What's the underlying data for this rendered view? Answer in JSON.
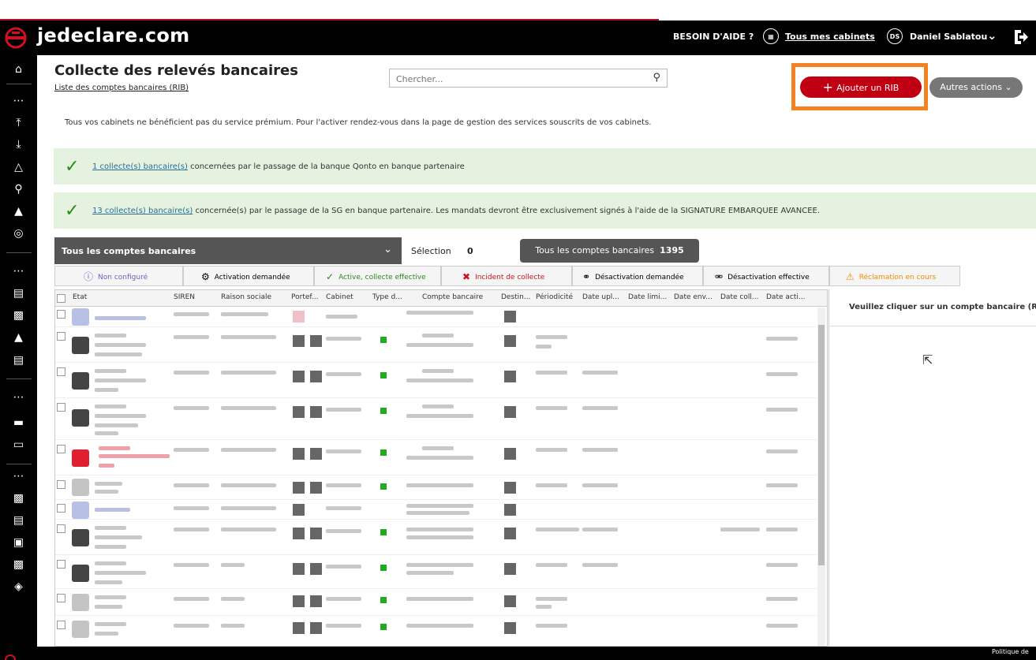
{
  "header": {
    "brand": "jedeclare.com",
    "help": "BESOIN D'AIDE ?",
    "cabinets": "Tous mes cabinets",
    "user_initials": "DS",
    "user_name": "Daniel Sablatou",
    "icons": [
      "logo-icon",
      "building-icon",
      "chevron-down-icon",
      "logout-icon"
    ]
  },
  "page": {
    "title": "Collecte des relevés bancaires",
    "subtitle_link": "Liste des comptes bancaires (RIB)",
    "search_placeholder": "Chercher...",
    "add_rib": "Ajouter un RIB",
    "other_actions": "Autres actions",
    "premium_note": "Tous vos cabinets ne bénéficient pas du service prémium. Pour l'activer rendez-vous dans la page de gestion des services souscrits de vos cabinets."
  },
  "banners": [
    {
      "link": "1 collecte(s) bancaire(s)",
      "text": " concernées par le passage de la banque Qonto en banque partenaire"
    },
    {
      "link": "13 collecte(s) bancaire(s)",
      "text": " concernée(s) par le passage de la SG en banque partenaire. Les mandats devront être exclusivement signés à l'aide de la SIGNATURE EMBARQUEE AVANCEE."
    }
  ],
  "selection": {
    "dropdown_label": "Tous les comptes bancaires",
    "selection_label": "Sélection",
    "selection_count": "0",
    "all_label": "Tous les comptes bancaires",
    "all_count": "1395"
  },
  "filters": [
    {
      "label": "Non configuré",
      "icon": "question-icon",
      "color": "#6b5fbf"
    },
    {
      "label": "Activation demandée",
      "icon": "gear-icon",
      "color": "#222222"
    },
    {
      "label": "Active, collecte effective",
      "icon": "check-icon",
      "color": "#2a8a1a"
    },
    {
      "label": "Incident de collecte",
      "icon": "cross-icon",
      "color": "#d01020"
    },
    {
      "label": "Désactivation demandée",
      "icon": "link-icon",
      "color": "#222222"
    },
    {
      "label": "Désactivation effective",
      "icon": "broken-link-icon",
      "color": "#222222"
    },
    {
      "label": "Réclamation en cours",
      "icon": "warning-icon",
      "color": "#f08c00"
    }
  ],
  "table": {
    "columns": [
      "Etat",
      "SIREN",
      "Raison sociale",
      "Portef...",
      "Cabinet",
      "Type d...",
      "Compte bancaire",
      "Destin...",
      "Périodicité",
      "Date upl...",
      "Date limi...",
      "Date env...",
      "Date coll...",
      "Date acti..."
    ]
  },
  "right_panel": {
    "placeholder": "Veuillez cliquer sur un compte bancaire (R"
  },
  "footer": {
    "text": "Politique de"
  }
}
